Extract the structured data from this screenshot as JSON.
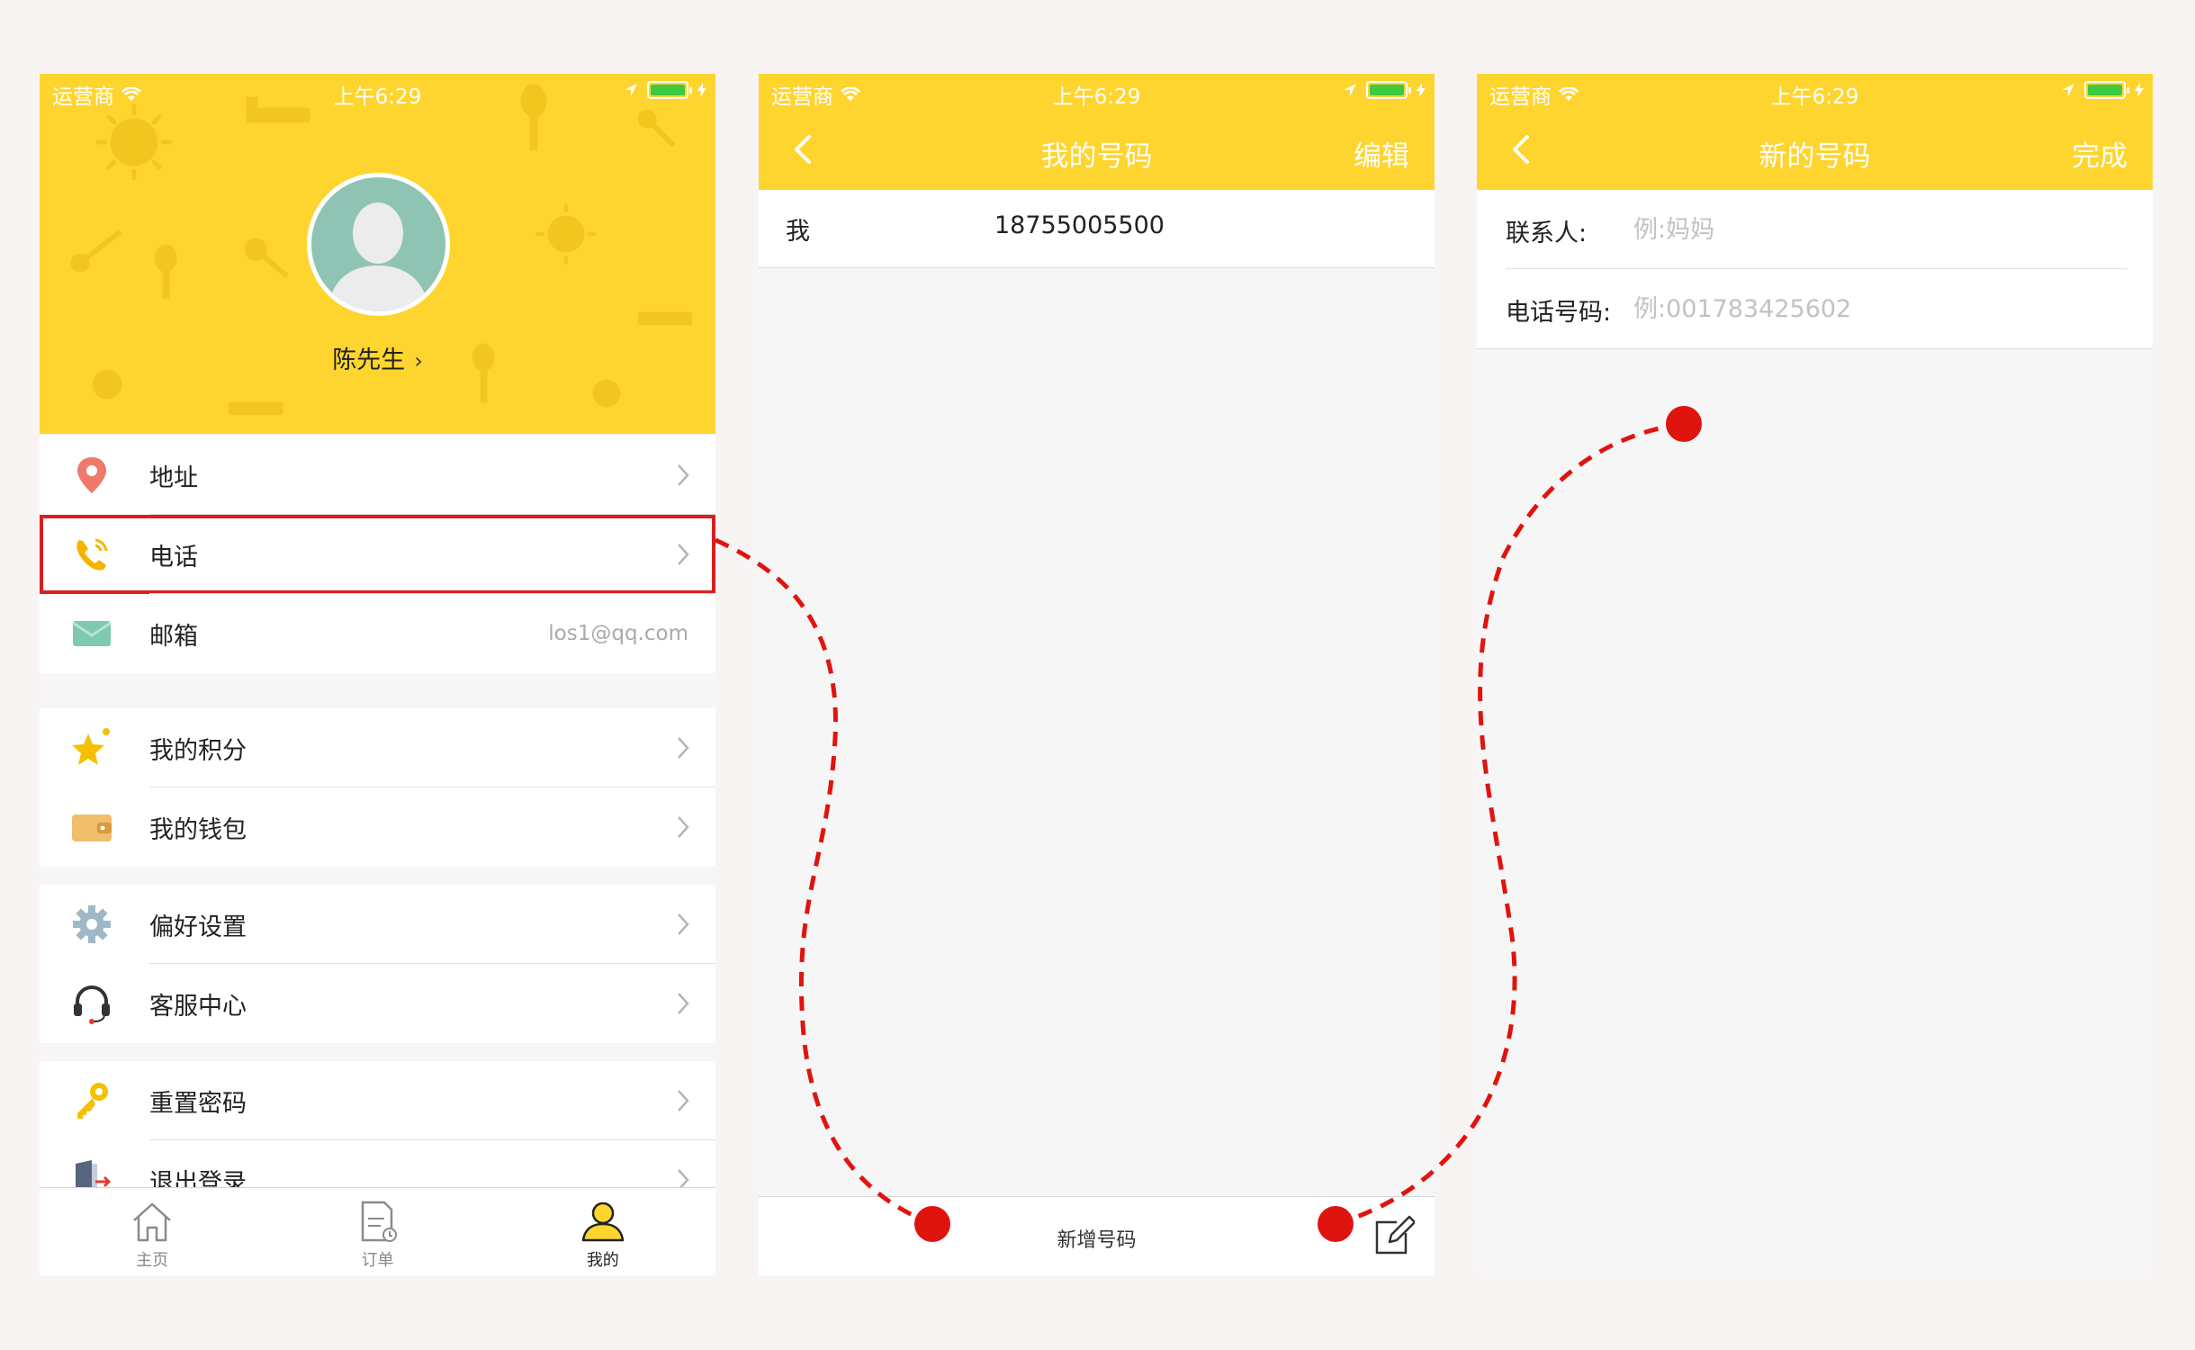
{
  "status_bar": {
    "carrier": "运营商",
    "time": "上午6:29"
  },
  "screen1": {
    "username": "陈先生",
    "groups": [
      [
        {
          "label": "地址",
          "icon": "location-pin-icon",
          "chevron": true
        },
        {
          "label": "电话",
          "icon": "phone-icon",
          "chevron": true,
          "highlighted": true
        },
        {
          "label": "邮箱",
          "icon": "mail-icon",
          "value": "los1@qq.com",
          "chevron": false
        }
      ],
      [
        {
          "label": "我的积分",
          "icon": "star-icon",
          "chevron": true
        },
        {
          "label": "我的钱包",
          "icon": "wallet-icon",
          "chevron": true
        }
      ],
      [
        {
          "label": "偏好设置",
          "icon": "gear-icon",
          "chevron": true
        },
        {
          "label": "客服中心",
          "icon": "headset-icon",
          "chevron": true
        }
      ],
      [
        {
          "label": "重置密码",
          "icon": "key-icon",
          "chevron": true
        },
        {
          "label": "退出登录",
          "icon": "logout-icon",
          "chevron": true
        }
      ]
    ],
    "tabbar": [
      {
        "label": "主页",
        "icon": "home-icon",
        "active": false
      },
      {
        "label": "订单",
        "icon": "order-document-icon",
        "active": false
      },
      {
        "label": "我的",
        "icon": "user-icon",
        "active": true
      }
    ]
  },
  "screen2": {
    "title": "我的号码",
    "action": "编辑",
    "contacts": [
      {
        "name": "我",
        "number": "18755005500"
      }
    ],
    "add_label": "新增号码"
  },
  "screen3": {
    "title": "新的号码",
    "action": "完成",
    "fields": [
      {
        "label": "联系人:",
        "placeholder": "例:妈妈",
        "value": ""
      },
      {
        "label": "电话号码:",
        "placeholder": "例:001783425602",
        "value": ""
      }
    ]
  },
  "colors": {
    "brand_yellow": "#fed52f",
    "highlight_red": "#d91f1f",
    "flow_dot_red": "#e0140f"
  }
}
